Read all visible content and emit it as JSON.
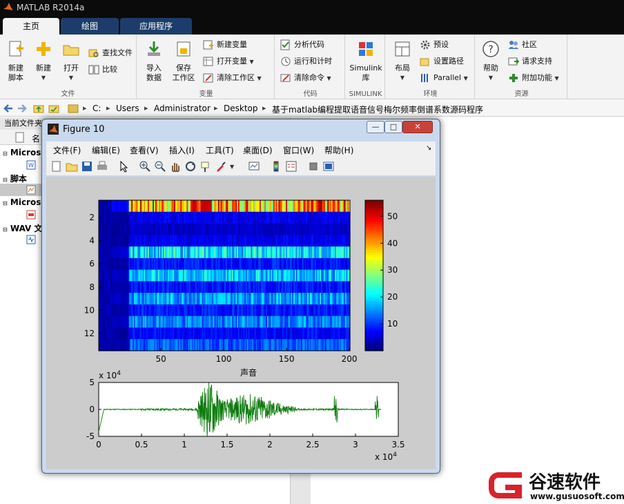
{
  "app": {
    "title": "MATLAB R2014a"
  },
  "tabs": [
    "主页",
    "绘图",
    "应用程序"
  ],
  "ribbon": {
    "file": {
      "label": "文件",
      "new_script": "新建\n脚本",
      "new": "新建",
      "open": "打开",
      "find_files": "查找文件",
      "compare": "比较"
    },
    "variable": {
      "label": "变量",
      "import": "导入\n数据",
      "save": "保存\n工作区",
      "new_var": "新建变量",
      "open_var": "打开变量",
      "clear_ws": "清除工作区"
    },
    "code": {
      "label": "代码",
      "analyze": "分析代码",
      "run_time": "运行和计时",
      "clear_cmd": "清除命令"
    },
    "simulink": {
      "label": "SIMULINK",
      "lib": "Simulink\n库"
    },
    "env": {
      "label": "环境",
      "layout": "布局",
      "prefs": "预设",
      "set_path": "设置路径",
      "parallel": "Parallel"
    },
    "resources": {
      "label": "资源",
      "help": "帮助",
      "community": "社区",
      "support": "请求支持",
      "addons": "附加功能"
    }
  },
  "address": [
    "C:",
    "Users",
    "Administrator",
    "Desktop",
    "基于matlab编程提取语音信号梅尔频率倒谱系数源码程序"
  ],
  "current_folder": {
    "title": "当前文件夹",
    "column_name": "名",
    "sections": [
      "Micros",
      "脚本",
      "Micros",
      "WAV 文"
    ]
  },
  "figure": {
    "title": "Figure 10",
    "menu": [
      "文件(F)",
      "编辑(E)",
      "查看(V)",
      "插入(I)",
      "工具(T)",
      "桌面(D)",
      "窗口(W)",
      "帮助(H)"
    ],
    "buttons": {
      "minimize": "—",
      "maximize": "□",
      "close": "✕"
    }
  },
  "colors": {
    "waveform": "#0a7a0a",
    "window_bg": "#c9d9ee",
    "axes_bg": "#cccccc"
  },
  "chart_data": [
    {
      "type": "heatmap",
      "title": "",
      "x_ticks": [
        50,
        100,
        150,
        200
      ],
      "y_ticks": [
        2,
        4,
        6,
        8,
        10,
        12
      ],
      "xlim": [
        1,
        200
      ],
      "ylim": [
        1,
        13
      ],
      "colorbar_ticks": [
        10,
        20,
        30,
        40,
        50
      ],
      "colorbar_range": [
        0,
        56
      ],
      "colormap": "jet",
      "row_levels": [
        40,
        6,
        4,
        6,
        20,
        8,
        18,
        8,
        16,
        8,
        14,
        7,
        12
      ]
    },
    {
      "type": "line",
      "title": "声音",
      "x_ticks": [
        0,
        0.5,
        1,
        1.5,
        2,
        2.5,
        3,
        3.5
      ],
      "y_ticks": [
        5,
        0,
        -5
      ],
      "x_exponent": "x 10^4",
      "y_exponent": "x 10^4",
      "xlim": [
        0,
        3.5
      ],
      "ylim": [
        -5,
        5
      ],
      "color": "#0a7a0a"
    }
  ],
  "watermark": {
    "brand": "谷速软件",
    "url": "www.gusuosoft.com"
  }
}
